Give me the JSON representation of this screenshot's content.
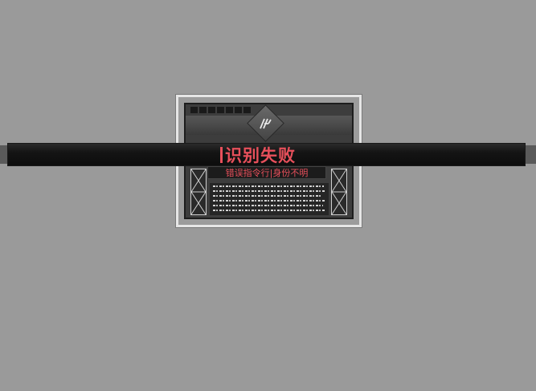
{
  "dialog": {
    "title": "识别失败",
    "subtitle": "错误指令行|身份不明"
  },
  "icons": {
    "emblem": "faction-emblem-icon",
    "left_box": "cross-box-icon",
    "right_box": "cross-box-icon"
  },
  "colors": {
    "accent_red": "#e8505b",
    "background": "#9a9a9a",
    "banner": "#141414",
    "panel": "#3d3d3d"
  }
}
